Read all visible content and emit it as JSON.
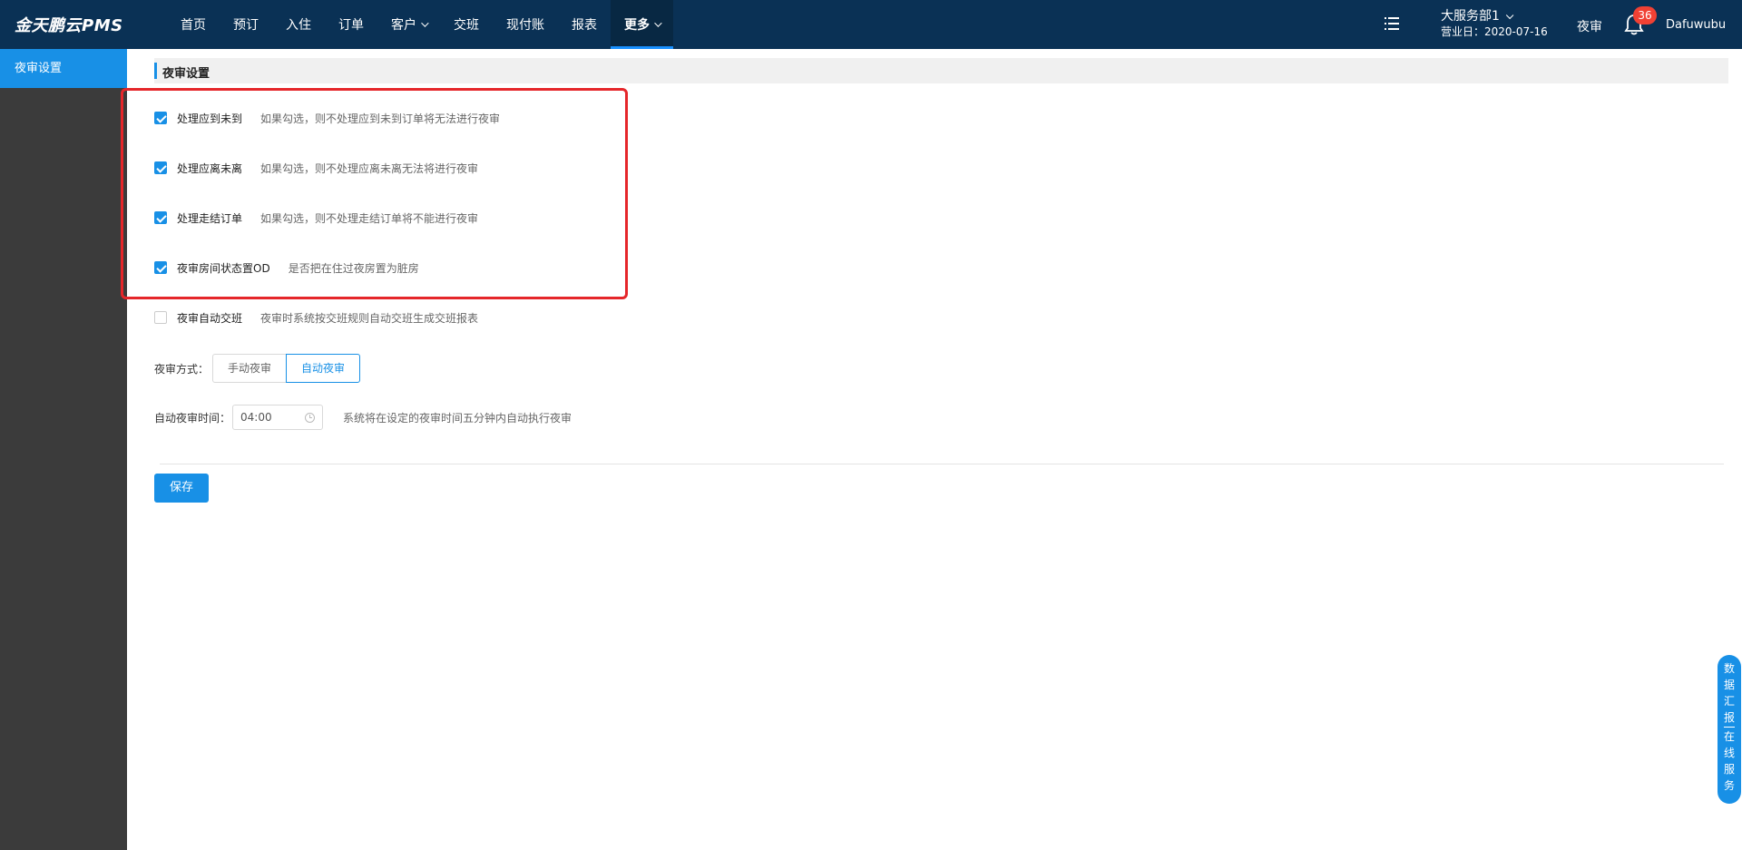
{
  "app": {
    "logo": "金天鹏云PMS"
  },
  "nav": {
    "items": [
      {
        "label": "首页"
      },
      {
        "label": "预订"
      },
      {
        "label": "入住"
      },
      {
        "label": "订单"
      },
      {
        "label": "客户"
      },
      {
        "label": "交班"
      },
      {
        "label": "现付账"
      },
      {
        "label": "报表"
      },
      {
        "label": "更多"
      }
    ]
  },
  "header": {
    "store_name": "大服务部1",
    "business_date": "营业日：2020-07-16",
    "night_audit": "夜审",
    "notification_count": "36",
    "username": "Dafuwubu"
  },
  "sidebar": {
    "items": [
      {
        "label": "夜审设置"
      }
    ]
  },
  "section": {
    "title": "夜审设置"
  },
  "options": [
    {
      "label": "处理应到未到",
      "desc": "如果勾选，则不处理应到未到订单将无法进行夜审",
      "checked": true
    },
    {
      "label": "处理应离未离",
      "desc": "如果勾选，则不处理应离未离无法将进行夜审",
      "checked": true
    },
    {
      "label": "处理走结订单",
      "desc": "如果勾选，则不处理走结订单将不能进行夜审",
      "checked": true
    },
    {
      "label": "夜审房间状态置OD",
      "desc": "是否把在住过夜房置为脏房",
      "checked": true
    },
    {
      "label": "夜审自动交班",
      "desc": "夜审时系统按交班规则自动交班生成交班报表",
      "checked": false
    }
  ],
  "mode": {
    "label": "夜审方式：",
    "options": [
      "手动夜审",
      "自动夜审"
    ],
    "selected": "自动夜审"
  },
  "auto_time": {
    "label": "自动夜审时间：",
    "value": "04:00",
    "desc": "系统将在设定的夜审时间五分钟内自动执行夜审"
  },
  "save_label": "保存",
  "float_tab": {
    "top": [
      "数",
      "据",
      "汇",
      "报"
    ],
    "bottom": [
      "在",
      "线",
      "服",
      "务"
    ]
  },
  "colors": {
    "nav_bg": "#0a3155",
    "accent": "#1890e6",
    "sidebar_bg": "#3b3b3b",
    "highlight": "#e5262a",
    "badge": "#f04134"
  }
}
